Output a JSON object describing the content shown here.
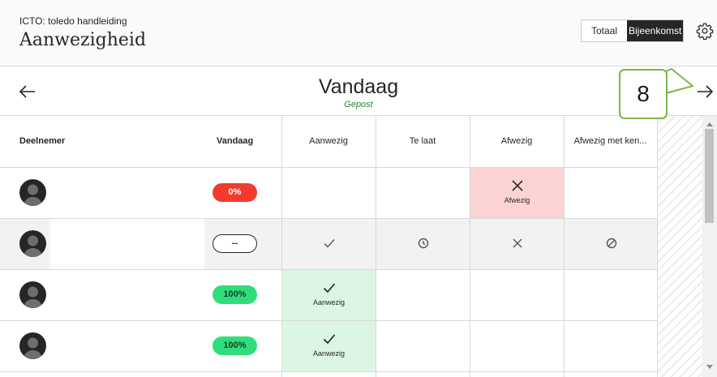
{
  "header": {
    "course": "ICTO: toledo handleiding",
    "title": "Aanwezigheid",
    "view_toggle": [
      "Totaal",
      "Bijeenkomst"
    ],
    "active_view": "Bijeenkomst"
  },
  "date_nav": {
    "day": "Vandaag",
    "status": "Gepost"
  },
  "callout": {
    "number": "8",
    "color": "#7ab648"
  },
  "table": {
    "headers": {
      "participant": "Deelnemer",
      "today": "Vandaag",
      "present": "Aanwezig",
      "late": "Te laat",
      "absent": "Afwezig",
      "excused": "Afwezig met ken..."
    },
    "rows": [
      {
        "avatar": "avatar-icon",
        "score": "0%",
        "score_style": "red",
        "selected": "absent",
        "selected_label": "Afwezig"
      },
      {
        "avatar": "avatar-icon",
        "score": "--",
        "score_style": "empty",
        "selected": "none",
        "selected_label": ""
      },
      {
        "avatar": "avatar-icon",
        "score": "100%",
        "score_style": "green",
        "selected": "present",
        "selected_label": "Aanwezig"
      },
      {
        "avatar": "avatar-icon",
        "score": "100%",
        "score_style": "green",
        "selected": "present",
        "selected_label": "Aanwezig"
      }
    ]
  },
  "icons": {
    "prev": "arrow-left-icon",
    "next": "arrow-right-icon",
    "settings": "gear-icon",
    "present": "check-icon",
    "late": "clock-icon",
    "absent": "x-icon",
    "excused": "circle-slash-icon"
  },
  "colors": {
    "absent_bg": "#fbd3d3",
    "present_bg": "#dcf6e3",
    "pill_red": "#f23b2e",
    "pill_green": "#2fde7a",
    "posted": "#2f7d38"
  }
}
